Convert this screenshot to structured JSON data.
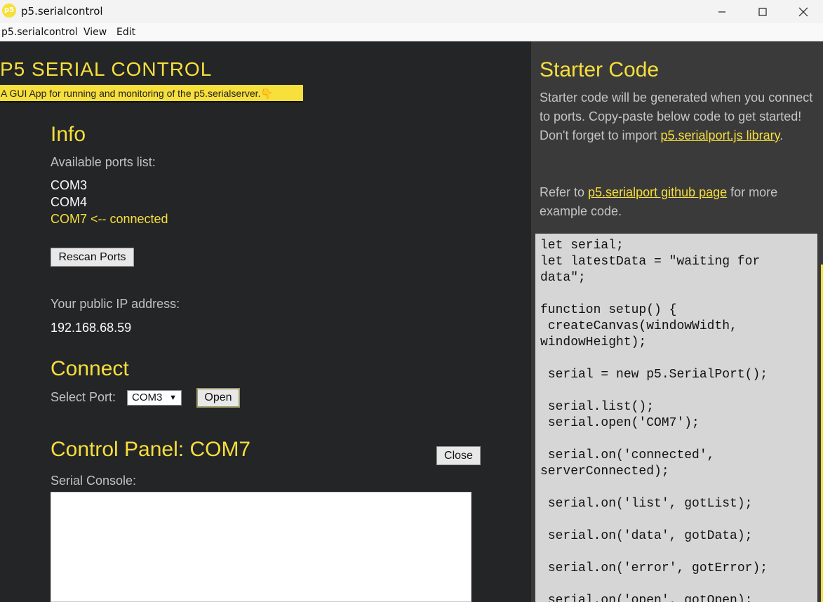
{
  "window": {
    "icon_text": "p5",
    "title": "p5.serialcontrol"
  },
  "menu": [
    "p5.serialcontrol",
    "View",
    "Edit"
  ],
  "header": {
    "brand": "P5 SERIAL CONTROL",
    "tagline": "A GUI App for running and monitoring of the p5.serialserver.",
    "tagline_emoji": "👇"
  },
  "info": {
    "title": "Info",
    "ports_label": "Available ports list:",
    "ports": [
      "COM3",
      "COM4",
      "COM7 <-- connected"
    ],
    "rescan_label": "Rescan Ports",
    "ip_label": "Your public IP address:",
    "ip_value": "192.168.68.59"
  },
  "connect": {
    "title": "Connect",
    "select_label": "Select Port:",
    "selected_port": "COM3",
    "open_label": "Open"
  },
  "control_panel": {
    "title": "Control Panel: COM7",
    "close_label": "Close",
    "console_label": "Serial Console:"
  },
  "starter": {
    "title": "Starter Code",
    "intro_prefix": "Starter code will be generated when you connect to ports. Copy-paste below code to get started! Don't forget to import ",
    "intro_link": "p5.serialport.js library",
    "intro_suffix": ".",
    "refer_prefix": "Refer to ",
    "refer_link": "p5.serialport github page",
    "refer_suffix": " for more example code.",
    "code": "let serial;\nlet latestData = \"waiting for data\";\n\nfunction setup() {\n createCanvas(windowWidth, windowHeight);\n\n serial = new p5.SerialPort();\n\n serial.list();\n serial.open('COM7');\n\n serial.on('connected', serverConnected);\n\n serial.on('list', gotList);\n\n serial.on('data', gotData);\n\n serial.on('error', gotError);\n\n serial.on('open', gotOpen);"
  },
  "colors": {
    "accent": "#f7df3c",
    "left_bg": "#232527",
    "right_bg": "#3a3a3a",
    "code_bg": "#d6d6d6"
  }
}
